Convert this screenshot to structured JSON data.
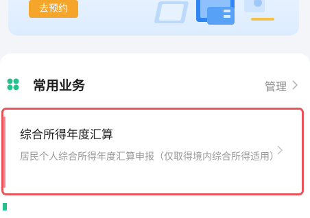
{
  "banner": {
    "button_label": "去预约"
  },
  "section": {
    "title": "常用业务",
    "manage_label": "管理"
  },
  "item": {
    "title": "综合所得年度汇算",
    "description": "居民个人综合所得年度汇算申报（仅取得境内综合所得适用）"
  },
  "colors": {
    "accent_orange": "#f4a52a",
    "highlight_red": "#e8545a",
    "brand_green": "#27c08c"
  },
  "icons": [
    "grid-icon",
    "chevron-right-icon"
  ]
}
